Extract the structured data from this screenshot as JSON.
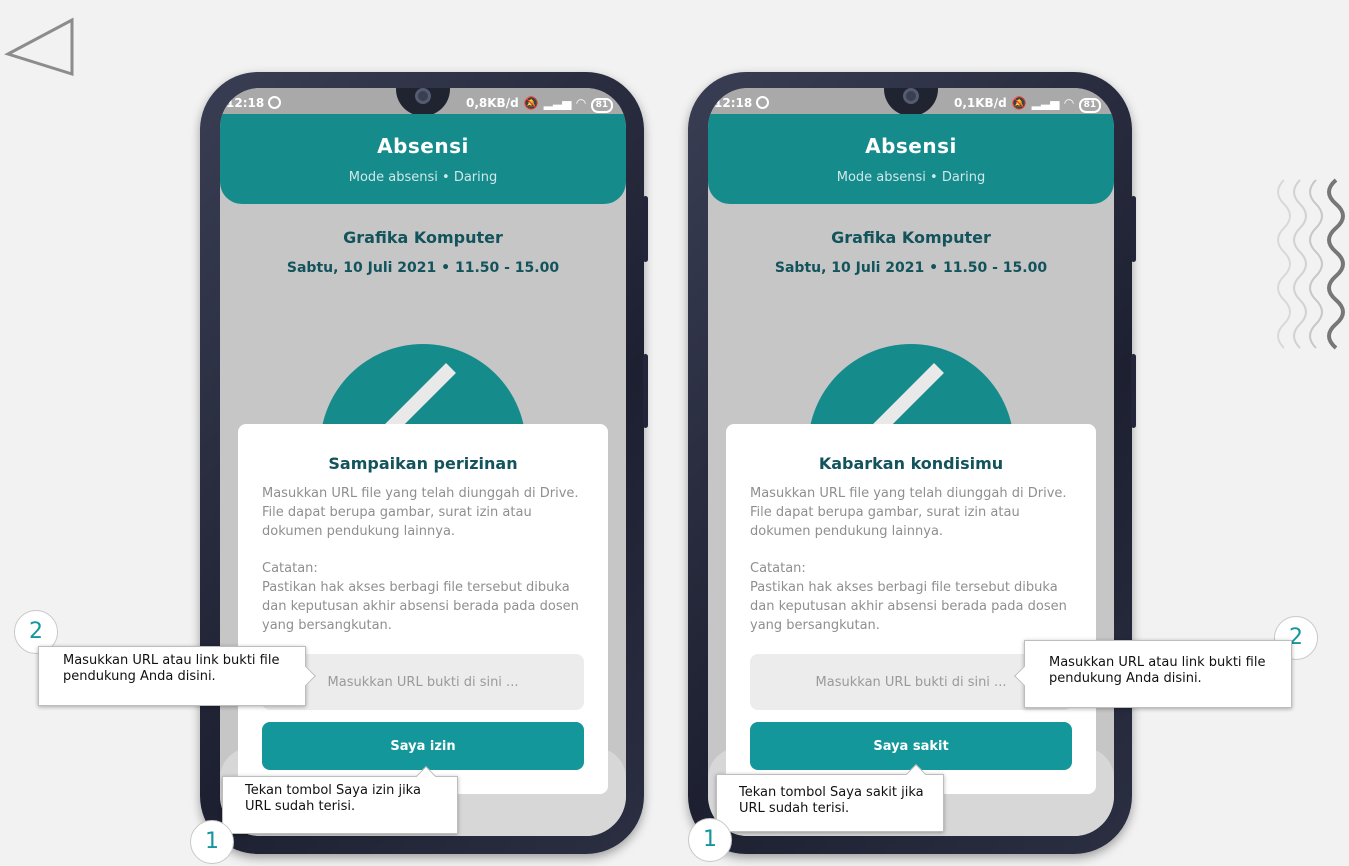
{
  "phones": [
    {
      "status": {
        "time": "12:18",
        "net_speed": "0,8KB/d",
        "battery": "81"
      },
      "header": {
        "title": "Absensi",
        "subtitle": "Mode absensi • Daring"
      },
      "course": {
        "name": "Grafika Komputer",
        "schedule": "Sabtu, 10 Juli 2021 • 11.50 - 15.00"
      },
      "dialog": {
        "title": "Sampaikan perizinan",
        "desc": "Masukkan URL file yang telah diunggah di Drive. File dapat berupa gambar, surat izin atau dokumen pendukung lainnya.",
        "note_label": "Catatan:",
        "note": "Pastikan hak akses berbagi file tersebut dibuka dan keputusan akhir absensi berada pada dosen yang bersangkutan.",
        "input_placeholder": "Masukkan URL bukti di sini ...",
        "button": "Saya izin"
      },
      "callout_url": {
        "number": "2",
        "text": "Masukkan URL atau link bukti file pendukung Anda disini."
      },
      "callout_button": {
        "number": "1",
        "text": "Tekan tombol Saya izin jika URL sudah terisi."
      }
    },
    {
      "status": {
        "time": "12:18",
        "net_speed": "0,1KB/d",
        "battery": "81"
      },
      "header": {
        "title": "Absensi",
        "subtitle": "Mode absensi • Daring"
      },
      "course": {
        "name": "Grafika Komputer",
        "schedule": "Sabtu, 10 Juli 2021 • 11.50 - 15.00"
      },
      "dialog": {
        "title": "Kabarkan kondisimu",
        "desc": "Masukkan URL file yang telah diunggah di Drive. File dapat berupa gambar, surat izin atau dokumen pendukung lainnya.",
        "note_label": "Catatan:",
        "note": "Pastikan hak akses berbagi file tersebut dibuka dan keputusan akhir absensi berada pada dosen yang bersangkutan.",
        "input_placeholder": "Masukkan URL bukti di sini ...",
        "button": "Saya sakit"
      },
      "callout_url": {
        "number": "2",
        "text": "Masukkan URL atau link bukti file pendukung Anda disini."
      },
      "callout_button": {
        "number": "1",
        "text": "Tekan tombol Saya sakit jika URL sudah terisi."
      }
    }
  ],
  "colors": {
    "teal": "#158b8c",
    "button": "#13979a",
    "title_text": "#13535c",
    "callout_number": "#1496a0"
  }
}
